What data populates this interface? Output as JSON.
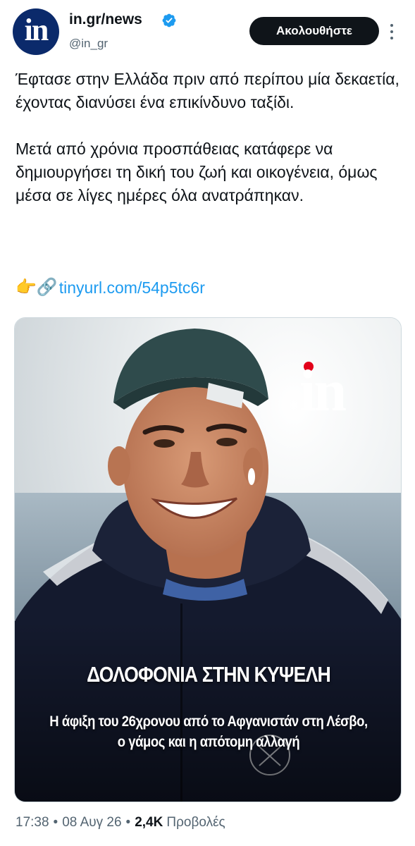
{
  "account": {
    "display_name": "in.gr/news",
    "handle": "@in_gr",
    "avatar_text": "in",
    "avatar_color": "#0b2a6b",
    "verified": true,
    "verified_icon": "verified-badge-icon",
    "follow_label": "Ακολουθήστε",
    "more_icon": "more-options-icon"
  },
  "tweet": {
    "paragraph1": "Έφτασε στην Ελλάδα πριν από περίπου μία δεκαετία, έχοντας διανύσει ένα επικίνδυνο ταξίδι.",
    "paragraph2": "Μετά από χρόνια προσπάθειας κατάφερε να δημιουργήσει τη δική του ζωή και οικογένεια, όμως μέσα σε λίγες ημέρες όλα ανατράπηκαν.",
    "emojis": "👉🔗",
    "link_text": "tinyurl.com/54p5tc6r"
  },
  "media": {
    "brand_logo": "in",
    "headline": "ΔΟΛΟΦΟΝΙΑ ΣΤΗΝ ΚΥΨΕΛΗ",
    "subhead_line1": "Η άφιξη του 26χρονου από το Αφγανιστάν στη Λέσβο,",
    "subhead_line2": "ο γάμος και η απότομη αλλαγή"
  },
  "meta": {
    "time": "17:38",
    "date": "08 Αυγ 26",
    "views_count": "2,4K",
    "views_label": "Προβολές"
  },
  "colors": {
    "accent_link": "#1d9bf0",
    "text_primary": "#0f1419",
    "text_secondary": "#536471",
    "follow_bg": "#0f1419",
    "brand_red": "#e2001a"
  }
}
